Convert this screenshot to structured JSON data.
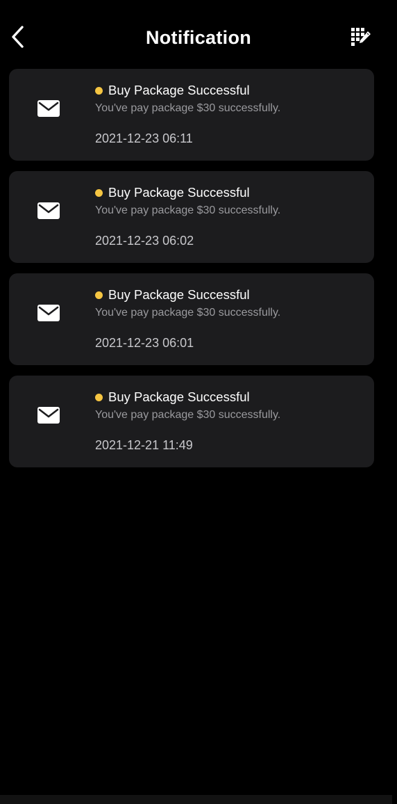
{
  "header": {
    "title": "Notification",
    "back_icon": "chevron-left-icon",
    "action_icon": "grid-edit-icon"
  },
  "colors": {
    "background": "#000000",
    "card": "#1c1c1e",
    "unread_dot": "#f5c542",
    "title_text": "#ffffff",
    "message_text": "#9a9a9e",
    "time_text": "#c8c8cc"
  },
  "notifications": [
    {
      "icon": "envelope-icon",
      "unread": true,
      "title": "Buy Package Successful",
      "message": "You've pay package $30 successfully.",
      "time": "2021-12-23 06:11"
    },
    {
      "icon": "envelope-icon",
      "unread": true,
      "title": "Buy Package Successful",
      "message": "You've pay package $30 successfully.",
      "time": "2021-12-23 06:02"
    },
    {
      "icon": "envelope-icon",
      "unread": true,
      "title": "Buy Package Successful",
      "message": "You've pay package $30 successfully.",
      "time": "2021-12-23 06:01"
    },
    {
      "icon": "envelope-icon",
      "unread": true,
      "title": "Buy Package Successful",
      "message": "You've pay package $30 successfully.",
      "time": "2021-12-21 11:49"
    }
  ]
}
